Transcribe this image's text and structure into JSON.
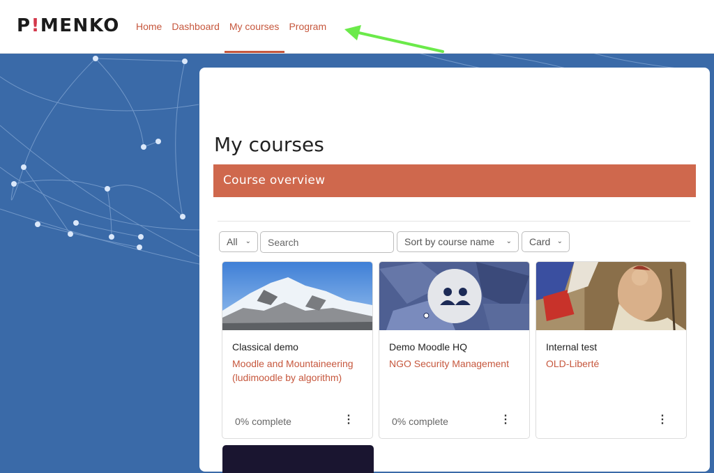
{
  "header": {
    "logo": {
      "left": "P",
      "mark": "!",
      "right": "MENKO"
    },
    "nav": [
      {
        "label": "Home"
      },
      {
        "label": "Dashboard"
      },
      {
        "label": "My courses"
      },
      {
        "label": "Program"
      }
    ],
    "active_nav": "My courses"
  },
  "page": {
    "title": "My courses",
    "section_title": "Course overview"
  },
  "filters": {
    "grouping": "All",
    "search_placeholder": "Search",
    "sort": "Sort by course name",
    "view": "Card"
  },
  "courses": [
    {
      "category": "Classical demo",
      "name": "Moodle and Mountaineering (ludimoodle by algorithm)",
      "progress": "0% complete",
      "image": "mountain-snow-image"
    },
    {
      "category": "Demo Moodle HQ",
      "name": "NGO Security Management",
      "progress": "0% complete",
      "image": "group-discussion-image"
    },
    {
      "category": "Internal test",
      "name": "OLD-Liberté",
      "progress": "",
      "image": "liberty-painting-image"
    }
  ],
  "colors": {
    "accent": "#cf684d",
    "link": "#c6573d",
    "background": "#3a6aa8",
    "annotation_arrow": "#6bea4a"
  }
}
